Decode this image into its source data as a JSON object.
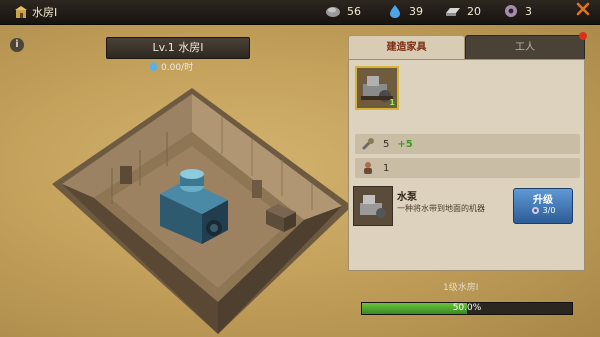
{
  "header": {
    "title": "水房I",
    "resources": [
      {
        "icon": "stone-icon",
        "value": "56"
      },
      {
        "icon": "water-drop-icon",
        "value": "39"
      },
      {
        "icon": "steel-icon",
        "value": "20"
      },
      {
        "icon": "gear-icon",
        "value": "3"
      }
    ]
  },
  "room": {
    "level_label": "Lv.1 水房I",
    "rate": "0.00/时"
  },
  "panel": {
    "tabs": [
      {
        "label": "建造家具"
      },
      {
        "label": "工人"
      }
    ],
    "slot_count": "1",
    "stat_rows": [
      {
        "icon": "wrench-icon",
        "value": "5",
        "bonus": "+5"
      },
      {
        "icon": "worker-icon",
        "value": "1"
      }
    ],
    "item": {
      "name": "水泵",
      "description": "一种将水带到地面的机器",
      "upgrade_label": "升级",
      "upgrade_count": "3/0"
    },
    "level_text": "1级水房I",
    "progress": {
      "percent": 50,
      "text": "50.0%"
    }
  },
  "colors": {
    "accent_orange": "#e0731f",
    "progress_green": "#4fa82e",
    "upgrade_blue": "#3a6fae",
    "annotation_red": "#e02020"
  }
}
